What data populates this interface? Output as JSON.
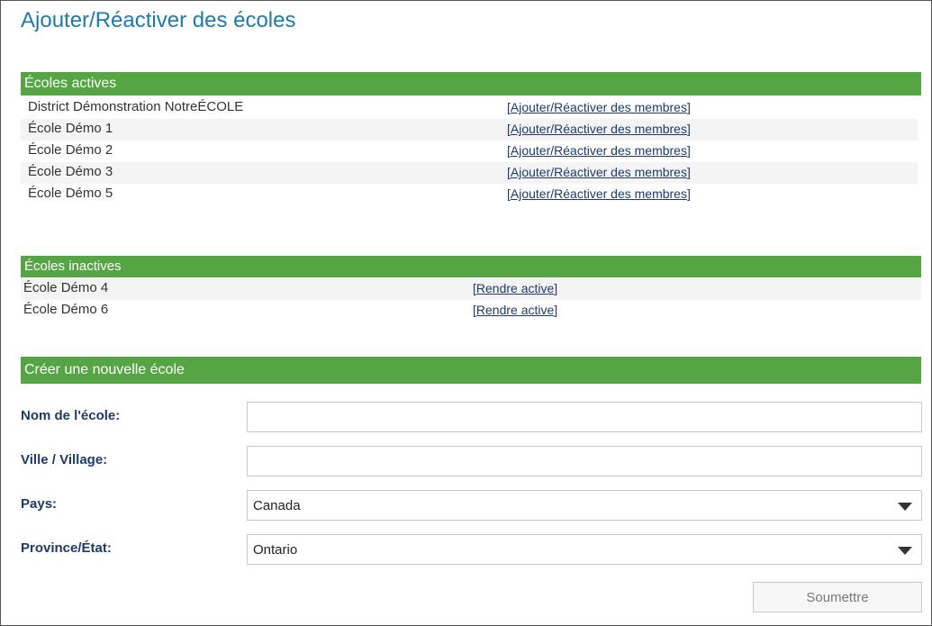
{
  "page_title": "Ajouter/Réactiver des écoles",
  "active_section": {
    "title": "Écoles actives",
    "rows": [
      {
        "name": "District Démonstration NotreÉCOLE",
        "action": "Ajouter/Réactiver des membres"
      },
      {
        "name": "École Démo 1",
        "action": "Ajouter/Réactiver des membres"
      },
      {
        "name": "École Démo 2",
        "action": "Ajouter/Réactiver des membres"
      },
      {
        "name": "École Démo 3",
        "action": "Ajouter/Réactiver des membres"
      },
      {
        "name": "École Démo 5",
        "action": "Ajouter/Réactiver des membres"
      }
    ]
  },
  "inactive_section": {
    "title": "Écoles inactives",
    "rows": [
      {
        "name": "École Démo 4",
        "action": "Rendre active"
      },
      {
        "name": "École Démo 6",
        "action": "Rendre active"
      }
    ]
  },
  "new_school_section": {
    "title": "Créer une nouvelle école",
    "fields": {
      "school_name": {
        "label": "Nom de l'école:",
        "value": ""
      },
      "city": {
        "label": "Ville / Village:",
        "value": ""
      },
      "country": {
        "label": "Pays:",
        "selected": "Canada"
      },
      "province": {
        "label": "Province/État:",
        "selected": "Ontario"
      }
    },
    "submit_label": "Soumettre"
  },
  "colors": {
    "section_bar": "#55a544",
    "title": "#1f7aa8",
    "link": "#1d3a6b"
  },
  "icons": {
    "dropdown": "chevron-down-icon"
  }
}
